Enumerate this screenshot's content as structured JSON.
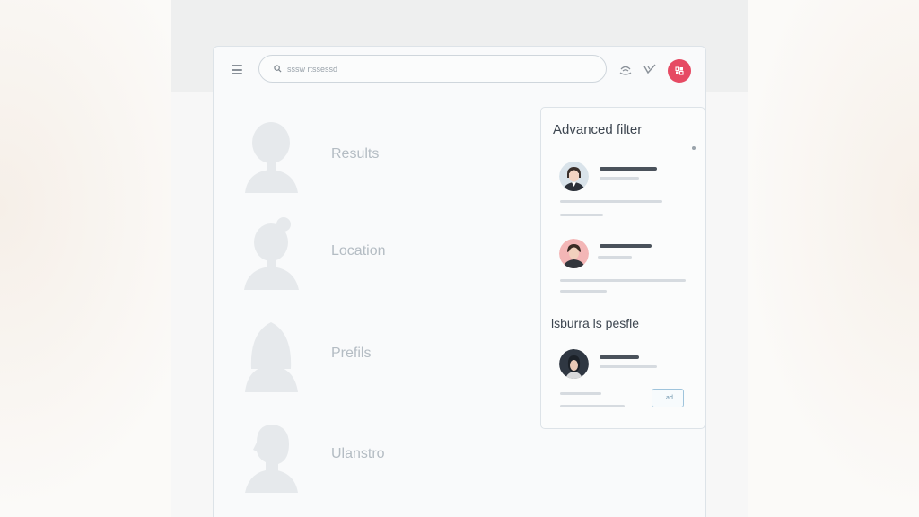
{
  "search": {
    "placeholder": "sssw rtssessd"
  },
  "list": {
    "items": [
      {
        "label": "Results"
      },
      {
        "label": "Location"
      },
      {
        "label": "Prefils"
      },
      {
        "label": "Ulanstro"
      }
    ]
  },
  "filter_panel": {
    "title": "Advanced filter",
    "section_title": "lsburra ls pesfle",
    "button_label": "..ad"
  },
  "colors": {
    "accent": "#e64a63",
    "button_border": "#9fc4dc",
    "silhouette": "#e6e9ec",
    "label_text": "#b4bcc3"
  },
  "icons": {
    "menu": "hamburger-icon",
    "search": "search-icon",
    "top_left": "wifi-hand-icon",
    "top_right": "checkmark-icon",
    "profile": "profile-icon"
  }
}
